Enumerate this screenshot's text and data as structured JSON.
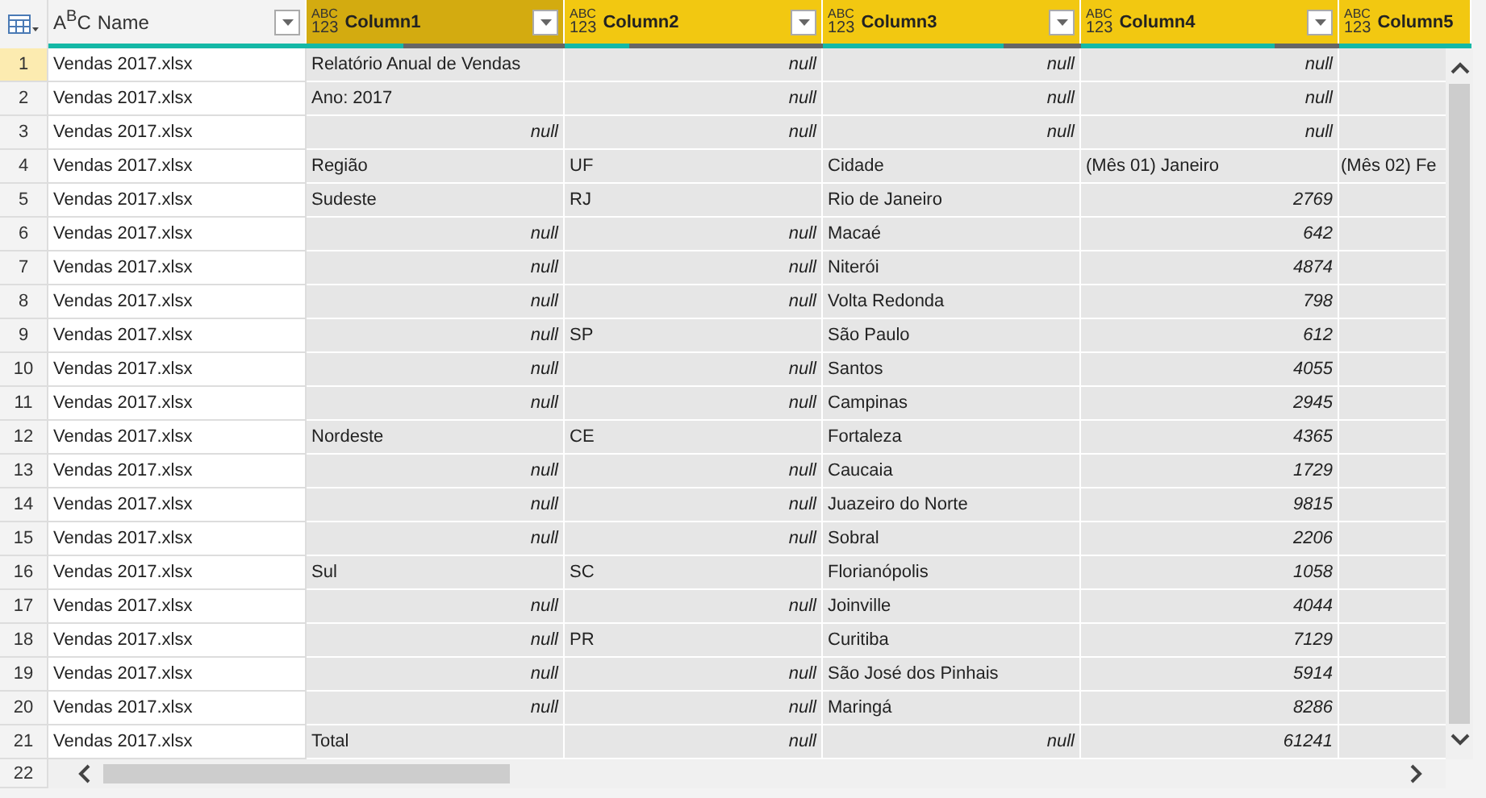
{
  "columns": [
    {
      "name": "Name",
      "type_letters": [
        "A",
        "B",
        "C"
      ],
      "kind": "text",
      "selected": false,
      "level": 1,
      "filter": true
    },
    {
      "name": "Column1",
      "type_letters": [
        "ABC",
        "123"
      ],
      "kind": "any",
      "selected": true,
      "level": 0.375,
      "filter": true
    },
    {
      "name": "Column2",
      "type_letters": [
        "ABC",
        "123"
      ],
      "kind": "any",
      "selected": false,
      "level": 0.25,
      "filter": true
    },
    {
      "name": "Column3",
      "type_letters": [
        "ABC",
        "123"
      ],
      "kind": "any",
      "selected": false,
      "level": 0.7,
      "filter": true
    },
    {
      "name": "Column4",
      "type_letters": [
        "ABC",
        "123"
      ],
      "kind": "any",
      "selected": false,
      "level": 0.75,
      "filter": true
    },
    {
      "name": "Column5",
      "type_letters": [
        "ABC",
        "123"
      ],
      "kind": "any",
      "selected": false,
      "level": 1,
      "filter": false
    }
  ],
  "rows": [
    {
      "number": "1",
      "selected": true,
      "cells": [
        {
          "text": "Vendas 2017.xlsx",
          "kind": "text"
        },
        {
          "text": "Relatório Anual de Vendas",
          "kind": "text"
        },
        {
          "text": "null",
          "kind": "null"
        },
        {
          "text": "null",
          "kind": "null"
        },
        {
          "text": "null",
          "kind": "null"
        }
      ]
    },
    {
      "number": "2",
      "selected": false,
      "cells": [
        {
          "text": "Vendas 2017.xlsx",
          "kind": "text"
        },
        {
          "text": "Ano: 2017",
          "kind": "text"
        },
        {
          "text": "null",
          "kind": "null"
        },
        {
          "text": "null",
          "kind": "null"
        },
        {
          "text": "null",
          "kind": "null"
        }
      ]
    },
    {
      "number": "3",
      "selected": false,
      "cells": [
        {
          "text": "Vendas 2017.xlsx",
          "kind": "text"
        },
        {
          "text": "null",
          "kind": "null"
        },
        {
          "text": "null",
          "kind": "null"
        },
        {
          "text": "null",
          "kind": "null"
        },
        {
          "text": "null",
          "kind": "null"
        }
      ]
    },
    {
      "number": "4",
      "selected": false,
      "cells": [
        {
          "text": "Vendas 2017.xlsx",
          "kind": "text"
        },
        {
          "text": "Região",
          "kind": "text"
        },
        {
          "text": "UF",
          "kind": "text"
        },
        {
          "text": "Cidade",
          "kind": "text"
        },
        {
          "text": "(Mês 01) Janeiro",
          "kind": "text"
        },
        {
          "text": "(Mês 02) Fe",
          "kind": "text"
        }
      ]
    },
    {
      "number": "5",
      "selected": false,
      "cells": [
        {
          "text": "Vendas 2017.xlsx",
          "kind": "text"
        },
        {
          "text": "Sudeste",
          "kind": "text"
        },
        {
          "text": "RJ",
          "kind": "text"
        },
        {
          "text": "Rio de Janeiro",
          "kind": "text"
        },
        {
          "text": "2769",
          "kind": "number"
        }
      ]
    },
    {
      "number": "6",
      "selected": false,
      "cells": [
        {
          "text": "Vendas 2017.xlsx",
          "kind": "text"
        },
        {
          "text": "null",
          "kind": "null"
        },
        {
          "text": "null",
          "kind": "null"
        },
        {
          "text": "Macaé",
          "kind": "text"
        },
        {
          "text": "642",
          "kind": "number"
        }
      ]
    },
    {
      "number": "7",
      "selected": false,
      "cells": [
        {
          "text": "Vendas 2017.xlsx",
          "kind": "text"
        },
        {
          "text": "null",
          "kind": "null"
        },
        {
          "text": "null",
          "kind": "null"
        },
        {
          "text": "Niterói",
          "kind": "text"
        },
        {
          "text": "4874",
          "kind": "number"
        }
      ]
    },
    {
      "number": "8",
      "selected": false,
      "cells": [
        {
          "text": "Vendas 2017.xlsx",
          "kind": "text"
        },
        {
          "text": "null",
          "kind": "null"
        },
        {
          "text": "null",
          "kind": "null"
        },
        {
          "text": "Volta Redonda",
          "kind": "text"
        },
        {
          "text": "798",
          "kind": "number"
        }
      ]
    },
    {
      "number": "9",
      "selected": false,
      "cells": [
        {
          "text": "Vendas 2017.xlsx",
          "kind": "text"
        },
        {
          "text": "null",
          "kind": "null"
        },
        {
          "text": "SP",
          "kind": "text"
        },
        {
          "text": "São Paulo",
          "kind": "text"
        },
        {
          "text": "612",
          "kind": "number"
        }
      ]
    },
    {
      "number": "10",
      "selected": false,
      "cells": [
        {
          "text": "Vendas 2017.xlsx",
          "kind": "text"
        },
        {
          "text": "null",
          "kind": "null"
        },
        {
          "text": "null",
          "kind": "null"
        },
        {
          "text": "Santos",
          "kind": "text"
        },
        {
          "text": "4055",
          "kind": "number"
        }
      ]
    },
    {
      "number": "11",
      "selected": false,
      "cells": [
        {
          "text": "Vendas 2017.xlsx",
          "kind": "text"
        },
        {
          "text": "null",
          "kind": "null"
        },
        {
          "text": "null",
          "kind": "null"
        },
        {
          "text": "Campinas",
          "kind": "text"
        },
        {
          "text": "2945",
          "kind": "number"
        }
      ]
    },
    {
      "number": "12",
      "selected": false,
      "cells": [
        {
          "text": "Vendas 2017.xlsx",
          "kind": "text"
        },
        {
          "text": "Nordeste",
          "kind": "text"
        },
        {
          "text": "CE",
          "kind": "text"
        },
        {
          "text": "Fortaleza",
          "kind": "text"
        },
        {
          "text": "4365",
          "kind": "number"
        }
      ]
    },
    {
      "number": "13",
      "selected": false,
      "cells": [
        {
          "text": "Vendas 2017.xlsx",
          "kind": "text"
        },
        {
          "text": "null",
          "kind": "null"
        },
        {
          "text": "null",
          "kind": "null"
        },
        {
          "text": "Caucaia",
          "kind": "text"
        },
        {
          "text": "1729",
          "kind": "number"
        }
      ]
    },
    {
      "number": "14",
      "selected": false,
      "cells": [
        {
          "text": "Vendas 2017.xlsx",
          "kind": "text"
        },
        {
          "text": "null",
          "kind": "null"
        },
        {
          "text": "null",
          "kind": "null"
        },
        {
          "text": "Juazeiro do Norte",
          "kind": "text"
        },
        {
          "text": "9815",
          "kind": "number"
        }
      ]
    },
    {
      "number": "15",
      "selected": false,
      "cells": [
        {
          "text": "Vendas 2017.xlsx",
          "kind": "text"
        },
        {
          "text": "null",
          "kind": "null"
        },
        {
          "text": "null",
          "kind": "null"
        },
        {
          "text": "Sobral",
          "kind": "text"
        },
        {
          "text": "2206",
          "kind": "number"
        }
      ]
    },
    {
      "number": "16",
      "selected": false,
      "cells": [
        {
          "text": "Vendas 2017.xlsx",
          "kind": "text"
        },
        {
          "text": "Sul",
          "kind": "text"
        },
        {
          "text": "SC",
          "kind": "text"
        },
        {
          "text": "Florianópolis",
          "kind": "text"
        },
        {
          "text": "1058",
          "kind": "number"
        }
      ]
    },
    {
      "number": "17",
      "selected": false,
      "cells": [
        {
          "text": "Vendas 2017.xlsx",
          "kind": "text"
        },
        {
          "text": "null",
          "kind": "null"
        },
        {
          "text": "null",
          "kind": "null"
        },
        {
          "text": "Joinville",
          "kind": "text"
        },
        {
          "text": "4044",
          "kind": "number"
        }
      ]
    },
    {
      "number": "18",
      "selected": false,
      "cells": [
        {
          "text": "Vendas 2017.xlsx",
          "kind": "text"
        },
        {
          "text": "null",
          "kind": "null"
        },
        {
          "text": "PR",
          "kind": "text"
        },
        {
          "text": "Curitiba",
          "kind": "text"
        },
        {
          "text": "7129",
          "kind": "number"
        }
      ]
    },
    {
      "number": "19",
      "selected": false,
      "cells": [
        {
          "text": "Vendas 2017.xlsx",
          "kind": "text"
        },
        {
          "text": "null",
          "kind": "null"
        },
        {
          "text": "null",
          "kind": "null"
        },
        {
          "text": "São José dos Pinhais",
          "kind": "text"
        },
        {
          "text": "5914",
          "kind": "number"
        }
      ]
    },
    {
      "number": "20",
      "selected": false,
      "cells": [
        {
          "text": "Vendas 2017.xlsx",
          "kind": "text"
        },
        {
          "text": "null",
          "kind": "null"
        },
        {
          "text": "null",
          "kind": "null"
        },
        {
          "text": "Maringá",
          "kind": "text"
        },
        {
          "text": "8286",
          "kind": "number"
        }
      ]
    },
    {
      "number": "21",
      "selected": false,
      "cells": [
        {
          "text": "Vendas 2017.xlsx",
          "kind": "text"
        },
        {
          "text": "Total",
          "kind": "text"
        },
        {
          "text": "null",
          "kind": "null"
        },
        {
          "text": "null",
          "kind": "null"
        },
        {
          "text": "61241",
          "kind": "number"
        }
      ]
    }
  ],
  "footer_row": {
    "number": "22"
  }
}
